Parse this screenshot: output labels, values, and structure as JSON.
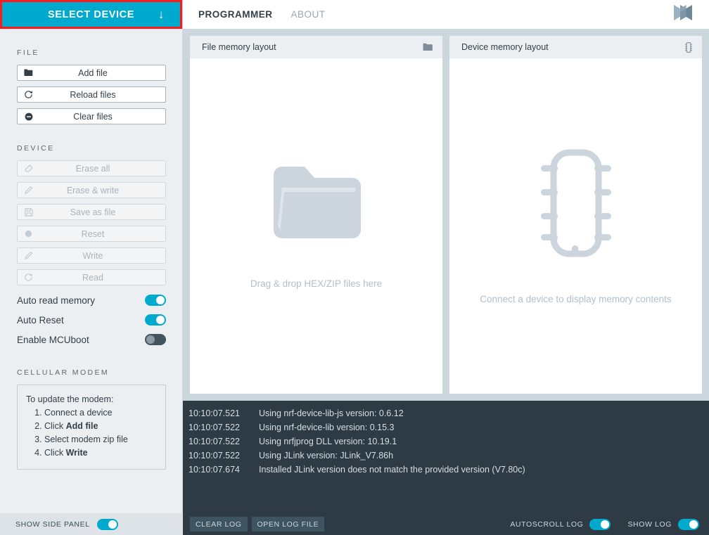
{
  "sidebar": {
    "select_device": {
      "label": "SELECT DEVICE",
      "icon": "arrow-down-icon",
      "arrow": "↓"
    },
    "file_section": {
      "title": "FILE"
    },
    "file_buttons": [
      {
        "label": "Add file",
        "icon": "folder-icon",
        "disabled": false
      },
      {
        "label": "Reload files",
        "icon": "reload-icon",
        "disabled": false
      },
      {
        "label": "Clear files",
        "icon": "minus-circle-icon",
        "disabled": false
      }
    ],
    "device_section": {
      "title": "DEVICE"
    },
    "device_buttons": [
      {
        "label": "Erase all",
        "icon": "eraser-icon",
        "disabled": true
      },
      {
        "label": "Erase & write",
        "icon": "pencil-icon",
        "disabled": true
      },
      {
        "label": "Save as file",
        "icon": "save-icon",
        "disabled": true
      },
      {
        "label": "Reset",
        "icon": "dot-icon",
        "disabled": true
      },
      {
        "label": "Write",
        "icon": "pencil-icon",
        "disabled": true
      },
      {
        "label": "Read",
        "icon": "reload-icon",
        "disabled": true
      }
    ],
    "toggles": [
      {
        "label": "Auto read memory",
        "state": "on"
      },
      {
        "label": "Auto Reset",
        "state": "on"
      },
      {
        "label": "Enable MCUboot",
        "state": "off"
      }
    ],
    "modem_section": {
      "title": "CELLULAR MODEM"
    },
    "modem_box": {
      "intro": "To update the modem:",
      "steps": [
        {
          "pre": "Connect a device",
          "bold": "",
          "post": ""
        },
        {
          "pre": "Click ",
          "bold": "Add file",
          "post": ""
        },
        {
          "pre": "Select modem zip file",
          "bold": "",
          "post": ""
        },
        {
          "pre": "Click ",
          "bold": "Write",
          "post": ""
        }
      ]
    }
  },
  "topbar": {
    "tabs": [
      {
        "label": "PROGRAMMER",
        "active": true
      },
      {
        "label": "ABOUT",
        "active": false
      }
    ],
    "logo": "nordic-semiconductor-logo"
  },
  "panels": [
    {
      "title": "File memory layout",
      "icon": "folder-icon",
      "graphic": "folder-graphic",
      "placeholder": "Drag & drop HEX/ZIP files here"
    },
    {
      "title": "Device memory layout",
      "icon": "chip-icon",
      "graphic": "chip-graphic",
      "placeholder": "Connect a device to display memory contents"
    }
  ],
  "log": {
    "entries": [
      {
        "time": "10:10:07.521",
        "message": "Using nrf-device-lib-js version: 0.6.12"
      },
      {
        "time": "10:10:07.522",
        "message": "Using nrf-device-lib version: 0.15.3"
      },
      {
        "time": "10:10:07.522",
        "message": "Using nrfjprog DLL version: 10.19.1"
      },
      {
        "time": "10:10:07.522",
        "message": "Using JLink version: JLink_V7.86h"
      },
      {
        "time": "10:10:07.674",
        "message": "Installed JLink version does not match the provided version (V7.80c)"
      }
    ]
  },
  "bottombar": {
    "show_side_panel": {
      "label": "SHOW SIDE PANEL",
      "state": "on"
    },
    "clear_log": "CLEAR LOG",
    "open_log_file": "OPEN LOG FILE",
    "autoscroll_log": {
      "label": "AUTOSCROLL LOG",
      "state": "on"
    },
    "show_log": {
      "label": "SHOW LOG",
      "state": "on"
    }
  },
  "colors": {
    "accent": "#00a9ce",
    "highlight": "#ff1a1a",
    "dark": "#2e3b44",
    "sidebar": "#eceff1",
    "placeholder": "#ccd4dd"
  }
}
